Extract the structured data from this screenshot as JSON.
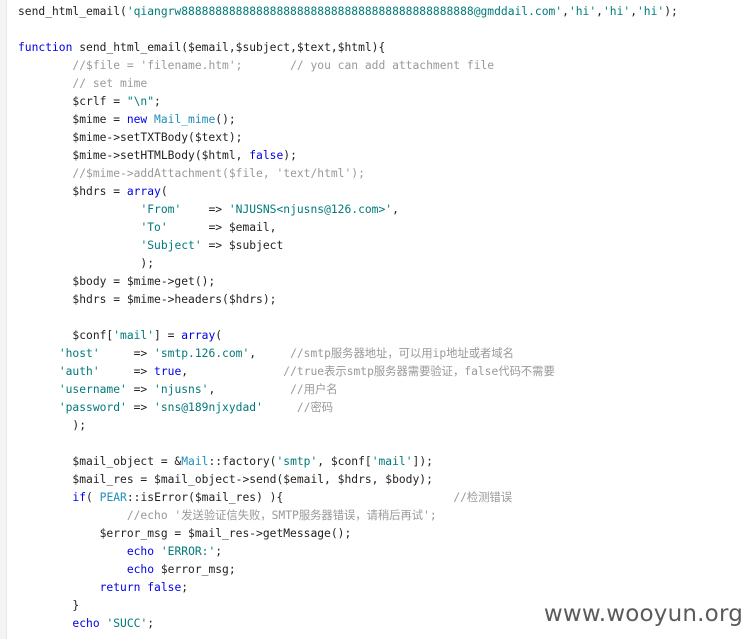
{
  "code_lines": [
    [
      {
        "t": "plain",
        "v": "send_html_email("
      },
      {
        "t": "str",
        "v": "'qiangrw8888888888888888888888888888888888888888888@gmddail.com'"
      },
      {
        "t": "plain",
        "v": ","
      },
      {
        "t": "str",
        "v": "'hi'"
      },
      {
        "t": "plain",
        "v": ","
      },
      {
        "t": "str",
        "v": "'hi'"
      },
      {
        "t": "plain",
        "v": ","
      },
      {
        "t": "str",
        "v": "'hi'"
      },
      {
        "t": "plain",
        "v": ");"
      }
    ],
    [],
    [
      {
        "t": "kw",
        "v": "function"
      },
      {
        "t": "plain",
        "v": " send_html_email($email,$subject,$text,$html){"
      }
    ],
    [
      {
        "t": "plain",
        "v": "        "
      },
      {
        "t": "cmt",
        "v": "//$file = 'filename.htm';       // you can add attachment file"
      }
    ],
    [
      {
        "t": "plain",
        "v": "        "
      },
      {
        "t": "cmt",
        "v": "// set mime"
      }
    ],
    [
      {
        "t": "plain",
        "v": "        $crlf = "
      },
      {
        "t": "str",
        "v": "\"\\n\""
      },
      {
        "t": "plain",
        "v": ";"
      }
    ],
    [
      {
        "t": "plain",
        "v": "        $mime = "
      },
      {
        "t": "kw",
        "v": "new"
      },
      {
        "t": "plain",
        "v": " "
      },
      {
        "t": "cls",
        "v": "Mail_mime"
      },
      {
        "t": "plain",
        "v": "();"
      }
    ],
    [
      {
        "t": "plain",
        "v": "        $mime->setTXTBody($text);"
      }
    ],
    [
      {
        "t": "plain",
        "v": "        $mime->setHTMLBody($html, "
      },
      {
        "t": "kw",
        "v": "false"
      },
      {
        "t": "plain",
        "v": ");"
      }
    ],
    [
      {
        "t": "plain",
        "v": "        "
      },
      {
        "t": "cmt",
        "v": "//$mime->addAttachment($file, 'text/html');"
      }
    ],
    [
      {
        "t": "plain",
        "v": "        $hdrs = "
      },
      {
        "t": "kw",
        "v": "array"
      },
      {
        "t": "plain",
        "v": "("
      }
    ],
    [
      {
        "t": "plain",
        "v": "                  "
      },
      {
        "t": "str",
        "v": "'From'"
      },
      {
        "t": "plain",
        "v": "    => "
      },
      {
        "t": "str",
        "v": "'NJUSNS<njusns@126.com>'"
      },
      {
        "t": "plain",
        "v": ","
      }
    ],
    [
      {
        "t": "plain",
        "v": "                  "
      },
      {
        "t": "str",
        "v": "'To'"
      },
      {
        "t": "plain",
        "v": "      => $email,"
      }
    ],
    [
      {
        "t": "plain",
        "v": "                  "
      },
      {
        "t": "str",
        "v": "'Subject'"
      },
      {
        "t": "plain",
        "v": " => $subject"
      }
    ],
    [
      {
        "t": "plain",
        "v": "                  );"
      }
    ],
    [
      {
        "t": "plain",
        "v": "        $body = $mime->get();"
      }
    ],
    [
      {
        "t": "plain",
        "v": "        $hdrs = $mime->headers($hdrs);"
      }
    ],
    [],
    [
      {
        "t": "plain",
        "v": "        $conf["
      },
      {
        "t": "str",
        "v": "'mail'"
      },
      {
        "t": "plain",
        "v": "] = "
      },
      {
        "t": "kw",
        "v": "array"
      },
      {
        "t": "plain",
        "v": "("
      }
    ],
    [
      {
        "t": "plain",
        "v": "      "
      },
      {
        "t": "str",
        "v": "'host'"
      },
      {
        "t": "plain",
        "v": "     => "
      },
      {
        "t": "str",
        "v": "'smtp.126.com'"
      },
      {
        "t": "plain",
        "v": ",     "
      },
      {
        "t": "cmt",
        "v": "//smtp服务器地址，可以用ip地址或者域名"
      }
    ],
    [
      {
        "t": "plain",
        "v": "      "
      },
      {
        "t": "str",
        "v": "'auth'"
      },
      {
        "t": "plain",
        "v": "     => "
      },
      {
        "t": "kw",
        "v": "true"
      },
      {
        "t": "plain",
        "v": ",              "
      },
      {
        "t": "cmt",
        "v": "//true表示smtp服务器需要验证，false代码不需要"
      }
    ],
    [
      {
        "t": "plain",
        "v": "      "
      },
      {
        "t": "str",
        "v": "'username'"
      },
      {
        "t": "plain",
        "v": " => "
      },
      {
        "t": "str",
        "v": "'njusns'"
      },
      {
        "t": "plain",
        "v": ",           "
      },
      {
        "t": "cmt",
        "v": "//用户名"
      }
    ],
    [
      {
        "t": "plain",
        "v": "      "
      },
      {
        "t": "str",
        "v": "'password'"
      },
      {
        "t": "plain",
        "v": " => "
      },
      {
        "t": "str",
        "v": "'sns@189njxydad'"
      },
      {
        "t": "plain",
        "v": "     "
      },
      {
        "t": "cmt",
        "v": "//密码"
      }
    ],
    [
      {
        "t": "plain",
        "v": "        );"
      }
    ],
    [],
    [
      {
        "t": "plain",
        "v": "        $mail_object = &"
      },
      {
        "t": "cls",
        "v": "Mail"
      },
      {
        "t": "plain",
        "v": "::factory("
      },
      {
        "t": "str",
        "v": "'smtp'"
      },
      {
        "t": "plain",
        "v": ", $conf["
      },
      {
        "t": "str",
        "v": "'mail'"
      },
      {
        "t": "plain",
        "v": "]);"
      }
    ],
    [
      {
        "t": "plain",
        "v": "        $mail_res = $mail_object->send($email, $hdrs, $body);"
      }
    ],
    [
      {
        "t": "plain",
        "v": "        "
      },
      {
        "t": "kw",
        "v": "if"
      },
      {
        "t": "plain",
        "v": "( "
      },
      {
        "t": "cls",
        "v": "PEAR"
      },
      {
        "t": "plain",
        "v": "::isError($mail_res) ){                         "
      },
      {
        "t": "cmt",
        "v": "//检测错误"
      }
    ],
    [
      {
        "t": "plain",
        "v": "                "
      },
      {
        "t": "cmt",
        "v": "//echo '发送验证信失败，SMTP服务器错误，请稍后再试';"
      }
    ],
    [
      {
        "t": "plain",
        "v": "            $error_msg = $mail_res->getMessage();"
      }
    ],
    [
      {
        "t": "plain",
        "v": "                "
      },
      {
        "t": "kw",
        "v": "echo"
      },
      {
        "t": "plain",
        "v": " "
      },
      {
        "t": "str",
        "v": "'ERROR:'"
      },
      {
        "t": "plain",
        "v": ";"
      }
    ],
    [
      {
        "t": "plain",
        "v": "                "
      },
      {
        "t": "kw",
        "v": "echo"
      },
      {
        "t": "plain",
        "v": " $error_msg;"
      }
    ],
    [
      {
        "t": "plain",
        "v": "            "
      },
      {
        "t": "kw",
        "v": "return"
      },
      {
        "t": "plain",
        "v": " "
      },
      {
        "t": "kw",
        "v": "false"
      },
      {
        "t": "plain",
        "v": ";"
      }
    ],
    [
      {
        "t": "plain",
        "v": "        }"
      }
    ],
    [
      {
        "t": "plain",
        "v": "        "
      },
      {
        "t": "kw",
        "v": "echo"
      },
      {
        "t": "plain",
        "v": " "
      },
      {
        "t": "str",
        "v": "'SUCC'"
      },
      {
        "t": "plain",
        "v": ";"
      }
    ]
  ],
  "watermark": "www.wooyun.org",
  "colors": {
    "keyword": "#0000e6",
    "string": "#007a7a",
    "comment": "#999999",
    "class": "#1f8fb8",
    "text": "#222222"
  }
}
